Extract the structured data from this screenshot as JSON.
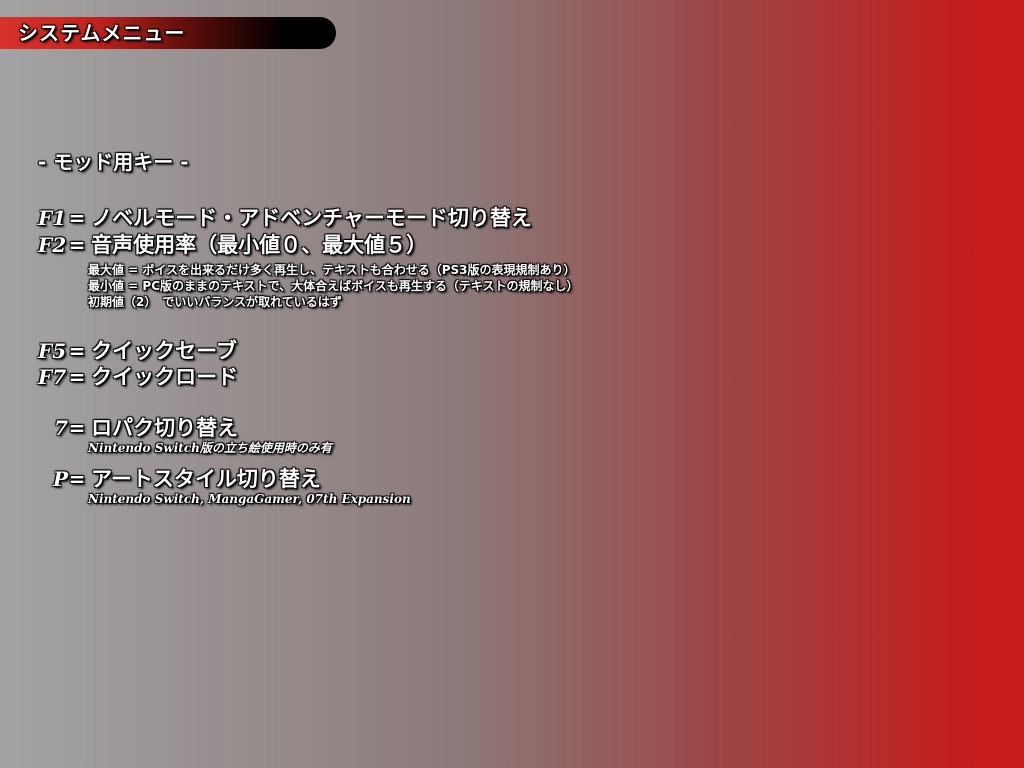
{
  "header": {
    "title": "システムメニュー"
  },
  "section": {
    "label": "- モッド用キー -"
  },
  "keys": {
    "f1": {
      "key": "F1",
      "sep": "=",
      "desc": "ノベルモード・アドベンチャーモード切り替え"
    },
    "f2": {
      "key": "F2",
      "sep": "=",
      "desc": "音声使用率（最小値０、最大値５）"
    },
    "f2_notes": [
      "最大値 = ボイスを出来るだけ多く再生し、テキストも合わせる（PS3版の表現規制あり）",
      "最小値 = PC版のままのテキストで、大体合えばボイスも再生する（テキストの規制なし）",
      "初期値（2）　でいいバランスが取れているはず"
    ],
    "f5": {
      "key": "F5",
      "sep": "=",
      "desc": "クイックセーブ"
    },
    "f7": {
      "key": "F7",
      "sep": "=",
      "desc": "クイックロード"
    },
    "seven": {
      "key": "7",
      "sep": "=",
      "desc": "ロパク切り替え",
      "note": "Nintendo Switch版の立ち絵使用時のみ有"
    },
    "p": {
      "key": "P",
      "sep": "=",
      "desc": "アートスタイル切り替え",
      "note": "Nintendo Switch, MangaGamer, 07th Expansion"
    }
  }
}
